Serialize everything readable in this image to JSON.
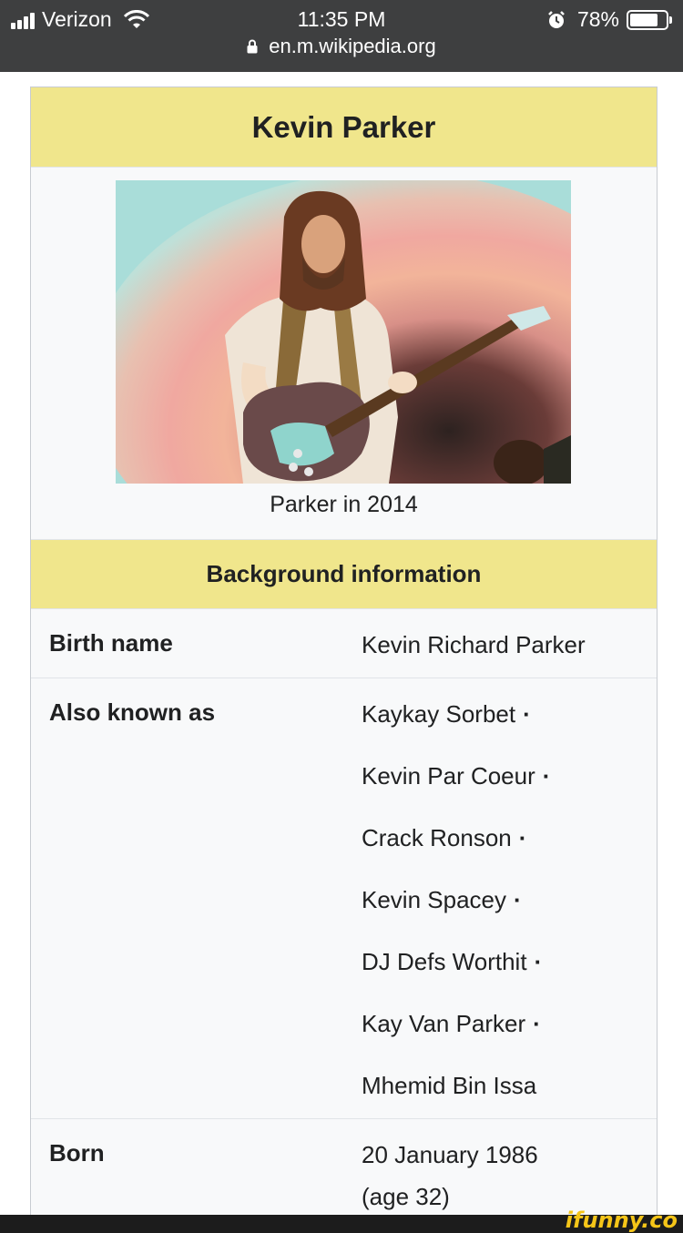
{
  "status_bar": {
    "carrier": "Verizon",
    "time": "11:35 PM",
    "battery_percent": "78%",
    "battery_level": 0.78,
    "url": "en.m.wikipedia.org"
  },
  "infobox": {
    "title": "Kevin Parker",
    "photo_caption": "Parker in 2014",
    "section_header": "Background information",
    "rows": {
      "birth_name": {
        "label": "Birth name",
        "value": "Kevin Richard Parker"
      },
      "also_known_as": {
        "label": "Also known as",
        "values": [
          "Kaykay Sorbet",
          "Kevin Par Coeur",
          "Crack Ronson",
          "Kevin Spacey",
          "DJ Defs Worthit",
          "Kay Van Parker",
          "Mhemid Bin Issa"
        ],
        "separator": "·"
      },
      "born": {
        "label": "Born",
        "date": "20 January 1986",
        "age": "(age 32)"
      }
    }
  },
  "watermark": "ifunny.co",
  "colors": {
    "status_bar_bg": "#3e3f40",
    "infobox_header_bg": "#f0e68c",
    "infobox_bg": "#f8f9fa"
  }
}
